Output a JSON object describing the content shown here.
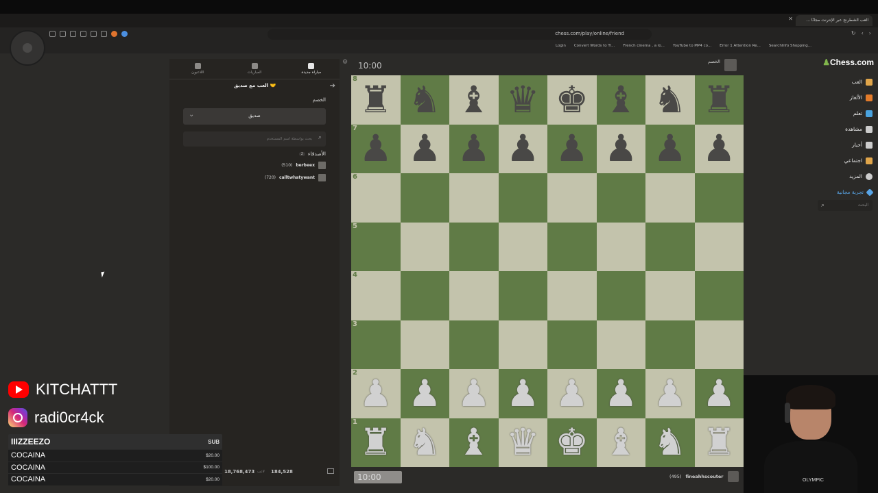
{
  "browser": {
    "tab_title": "العب الشطرنج عبر الإنترنت مجانًا ...",
    "url": "chess.com/play/online/friend",
    "bookmarks": [
      "Login",
      "Convert Words to Ti...",
      "French cinema , a lo...",
      "YouTube to MP4 co...",
      "Error 1 Attention Re...",
      "SearchInfo Shopping..."
    ]
  },
  "site": {
    "brand": "Chess.com",
    "nav": [
      {
        "label": "العب",
        "icon": "play-icon",
        "color": "#e0a54a"
      },
      {
        "label": "الألغاز",
        "icon": "puzzle-icon",
        "color": "#e37b2a"
      },
      {
        "label": "تعلم",
        "icon": "learn-icon",
        "color": "#4aa3df"
      },
      {
        "label": "مشاهدة",
        "icon": "watch-icon",
        "color": "#cccccc"
      },
      {
        "label": "أخبار",
        "icon": "news-icon",
        "color": "#cccccc"
      },
      {
        "label": "اجتماعي",
        "icon": "social-icon",
        "color": "#e0a54a"
      },
      {
        "label": "المزيد",
        "icon": "more-icon",
        "color": "#cccccc"
      }
    ],
    "trial": "تجربة مجانية",
    "search_placeholder": "البحث"
  },
  "panel": {
    "tabs": [
      {
        "label": "اللاعبون",
        "icon": "players-icon"
      },
      {
        "label": "المباريات",
        "icon": "games-icon"
      },
      {
        "label": "مباراة جديدة",
        "icon": "new-game-icon",
        "active": true
      }
    ],
    "play_friend": "العب مع صديق",
    "opponent_label": "الخصم",
    "opponent_select": "صديق",
    "user_search_placeholder": "بحث بواسطة اسم المستخدم",
    "friends_label": "الأصدقاء",
    "friends_count": "2",
    "friends": [
      {
        "name": "berbeex",
        "rating": "(510)"
      },
      {
        "name": "calltwhatywant",
        "rating": "(720)"
      }
    ],
    "footer": {
      "players": "18,768,473",
      "players_label": "لاعب",
      "games": "184,528"
    }
  },
  "game": {
    "clock_top": "10:00",
    "clock_bottom": "10:00",
    "opponent": "الخصم",
    "me": "fineahhscouter",
    "me_rating": "(495)",
    "ranks": [
      "8",
      "7",
      "6",
      "5",
      "4",
      "3",
      "2",
      "1"
    ],
    "position": [
      [
        "r",
        "n",
        "b",
        "q",
        "k",
        "b",
        "n",
        "r"
      ],
      [
        "p",
        "p",
        "p",
        "p",
        "p",
        "p",
        "p",
        "p"
      ],
      [
        "",
        "",
        "",
        "",
        "",
        "",
        "",
        ""
      ],
      [
        "",
        "",
        "",
        "",
        "",
        "",
        "",
        ""
      ],
      [
        "",
        "",
        "",
        "",
        "",
        "",
        "",
        ""
      ],
      [
        "",
        "",
        "",
        "",
        "",
        "",
        "",
        ""
      ],
      [
        "P",
        "P",
        "P",
        "P",
        "P",
        "P",
        "P",
        "P"
      ],
      [
        "R",
        "N",
        "B",
        "Q",
        "K",
        "B",
        "N",
        "R"
      ]
    ]
  },
  "overlay": {
    "youtube": "KITCHATTT",
    "instagram": "radi0cr4ck",
    "alert_title": "IIIZZEEZO",
    "alert_tag": "SUB",
    "alerts": [
      {
        "name": "COCAINA",
        "amount": "$20.00"
      },
      {
        "name": "COCAINA",
        "amount": "$100.00"
      },
      {
        "name": "COCAINA",
        "amount": "$20.00"
      }
    ],
    "webcam_shirt_text": "OLYMPIC"
  }
}
